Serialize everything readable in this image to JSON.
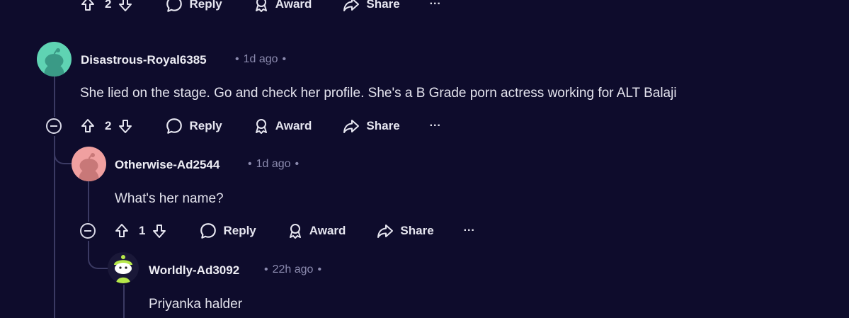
{
  "top_actions": {
    "vote_count": "2",
    "reply_label": "Reply",
    "award_label": "Award",
    "share_label": "Share",
    "more_label": "···"
  },
  "comments": [
    {
      "author": "Disastrous-Royal6385",
      "time": "1d ago",
      "body": "She lied on the stage. Go and check her profile. She's a B Grade porn actress working for ALT Balaji",
      "vote_count": "2",
      "reply_label": "Reply",
      "award_label": "Award",
      "share_label": "Share",
      "more_label": "···",
      "avatar_color": "#5fd3b3"
    },
    {
      "author": "Otherwise-Ad2544",
      "time": "1d ago",
      "body": "What's her name?",
      "vote_count": "1",
      "reply_label": "Reply",
      "award_label": "Award",
      "share_label": "Share",
      "more_label": "···",
      "avatar_color": "#f0a0a0"
    },
    {
      "author": "Worldly-Ad3092",
      "time": "22h ago",
      "body": "Priyanka halder",
      "avatar_color": "#b6e84a"
    }
  ],
  "dot_separator": "•",
  "colors": {
    "background": "#0e0c2c",
    "thread_line": "#3b3a63",
    "meta": "#8b8aae"
  }
}
